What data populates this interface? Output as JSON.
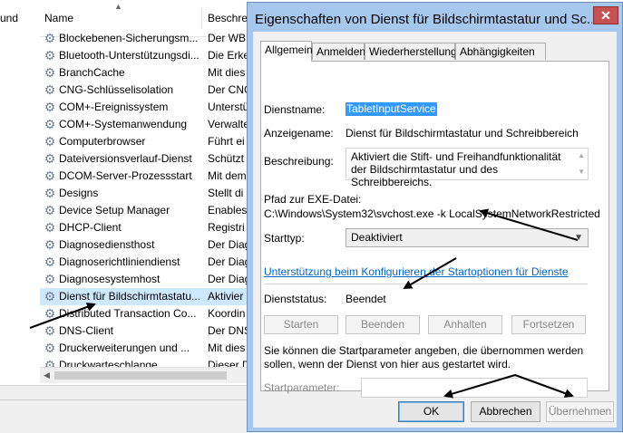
{
  "background": {
    "left_column_header": "und",
    "columns": {
      "name": "Name",
      "description": "Beschre"
    },
    "services": [
      {
        "name": "Blockebenen-Sicherungsm...",
        "desc": "Der WBE"
      },
      {
        "name": "Bluetooth-Unterstützungsdi...",
        "desc": "Die Erke"
      },
      {
        "name": "BranchCache",
        "desc": "Mit dies"
      },
      {
        "name": "CNG-Schlüsselisolation",
        "desc": "Der CNG"
      },
      {
        "name": "COM+-Ereignissystem",
        "desc": "Unterstü"
      },
      {
        "name": "COM+-Systemanwendung",
        "desc": "Verwalte"
      },
      {
        "name": "Computerbrowser",
        "desc": "Führt ei"
      },
      {
        "name": "Dateiversionsverlauf-Dienst",
        "desc": "Schützt"
      },
      {
        "name": "DCOM-Server-Prozessstart",
        "desc": "Mit dem"
      },
      {
        "name": "Designs",
        "desc": "Stellt di"
      },
      {
        "name": "Device Setup Manager",
        "desc": "Enables"
      },
      {
        "name": "DHCP-Client",
        "desc": "Registri"
      },
      {
        "name": "Diagnosediensthost",
        "desc": "Der Diag"
      },
      {
        "name": "Diagnoserichtliniendienst",
        "desc": "Der Diag"
      },
      {
        "name": "Diagnosesystemhost",
        "desc": "Der Diag"
      },
      {
        "name": "Dienst für Bildschirmtastatu...",
        "desc": "Aktivier"
      },
      {
        "name": "Distributed Transaction Co...",
        "desc": "Koordin"
      },
      {
        "name": "DNS-Client",
        "desc": "Der DNS"
      },
      {
        "name": "Druckerweiterungen und ...",
        "desc": "Mit dies"
      },
      {
        "name": "Druckwarteschlange",
        "desc": "Dieser D"
      }
    ],
    "selected_index": 15
  },
  "dialog": {
    "title": "Eigenschaften von Dienst für Bildschirmtastatur und Sc...",
    "close_glyph": "✕",
    "tabs": [
      "Allgemein",
      "Anmelden",
      "Wiederherstellung",
      "Abhängigkeiten"
    ],
    "active_tab": 0,
    "service_name_label": "Dienstname:",
    "service_name": "TabletInputService",
    "display_name_label": "Anzeigename:",
    "display_name": "Dienst für Bildschirmtastatur und Schreibbereich",
    "description_label": "Beschreibung:",
    "description": "Aktiviert die Stift- und Freihandfunktionalität der Bildschirmtastatur und des Schreibbereichs.",
    "exe_path_label": "Pfad zur EXE-Datei:",
    "exe_path": "C:\\Windows\\System32\\svchost.exe -k LocalSystemNetworkRestricted",
    "startup_type_label": "Starttyp:",
    "startup_type": "Deaktiviert",
    "help_link": "Unterstützung beim Konfigurieren der Startoptionen für Dienste",
    "status_label": "Dienststatus:",
    "status": "Beendet",
    "buttons": {
      "start": "Starten",
      "stop": "Beenden",
      "pause": "Anhalten",
      "resume": "Fortsetzen"
    },
    "start_params_info": "Sie können die Startparameter angeben, die übernommen werden sollen, wenn der Dienst von hier aus gestartet wird.",
    "start_params_label": "Startparameter:",
    "start_params_value": "",
    "footer": {
      "ok": "OK",
      "cancel": "Abbrechen",
      "apply": "Übernehmen"
    }
  },
  "colors": {
    "dialog_frame": "#a7c8ee",
    "selection": "#3399ff",
    "link": "#0066cc",
    "close_button": "#c75050"
  }
}
